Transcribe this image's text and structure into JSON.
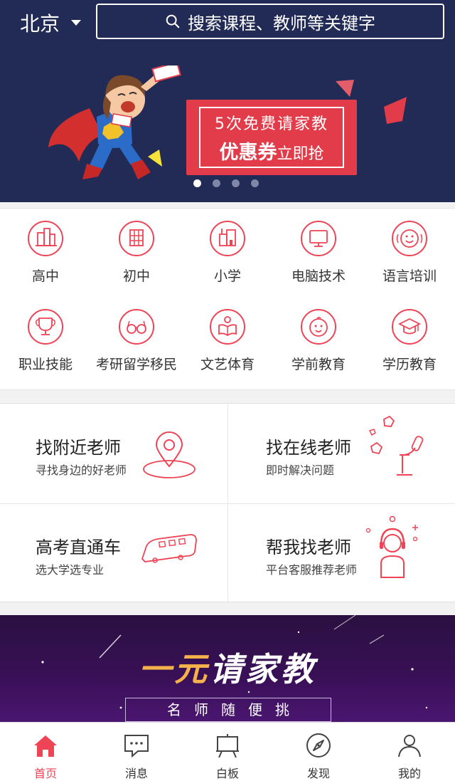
{
  "header": {
    "city": "北京",
    "search_placeholder": "搜索课程、教师等关键字"
  },
  "banner": {
    "coupon_line1": "5次免费请家教",
    "coupon_line2_bold": "优惠券",
    "coupon_line2_small": "立即抢",
    "slides_total": 4,
    "slide_active": 1
  },
  "categories": [
    {
      "label": "高中",
      "icon": "high-school-building-icon"
    },
    {
      "label": "初中",
      "icon": "middle-school-building-icon"
    },
    {
      "label": "小学",
      "icon": "primary-school-building-icon"
    },
    {
      "label": "电脑技术",
      "icon": "computer-monitor-icon"
    },
    {
      "label": "语言培训",
      "icon": "smiley-speech-icon"
    },
    {
      "label": "职业技能",
      "icon": "trophy-icon"
    },
    {
      "label": "考研留学移民",
      "icon": "glasses-icon"
    },
    {
      "label": "文艺体育",
      "icon": "person-book-icon"
    },
    {
      "label": "学前教育",
      "icon": "baby-face-icon"
    },
    {
      "label": "学历教育",
      "icon": "graduation-cap-icon"
    }
  ],
  "find_cards": [
    {
      "title": "找附近老师",
      "subtitle": "寻找身边的好老师",
      "icon": "location-pin-icon"
    },
    {
      "title": "找在线老师",
      "subtitle": "即时解决问题",
      "icon": "microscope-icon"
    },
    {
      "title": "高考直通车",
      "subtitle": "选大学选专业",
      "icon": "train-icon"
    },
    {
      "title": "帮我找老师",
      "subtitle": "平台客服推荐老师",
      "icon": "headset-agent-icon"
    }
  ],
  "promo": {
    "part1": "一元",
    "part2": "请家教",
    "tagline": "名师随便挑"
  },
  "tabs": [
    {
      "label": "首页",
      "icon": "home-icon",
      "active": true
    },
    {
      "label": "消息",
      "icon": "message-icon",
      "active": false
    },
    {
      "label": "白板",
      "icon": "whiteboard-icon",
      "active": false
    },
    {
      "label": "发现",
      "icon": "compass-icon",
      "active": false
    },
    {
      "label": "我的",
      "icon": "user-icon",
      "active": false
    }
  ],
  "colors": {
    "header_bg": "#222b55",
    "accent": "#ee4455",
    "coupon_red": "#e23b49",
    "promo_yellow": "#f5b24a"
  }
}
